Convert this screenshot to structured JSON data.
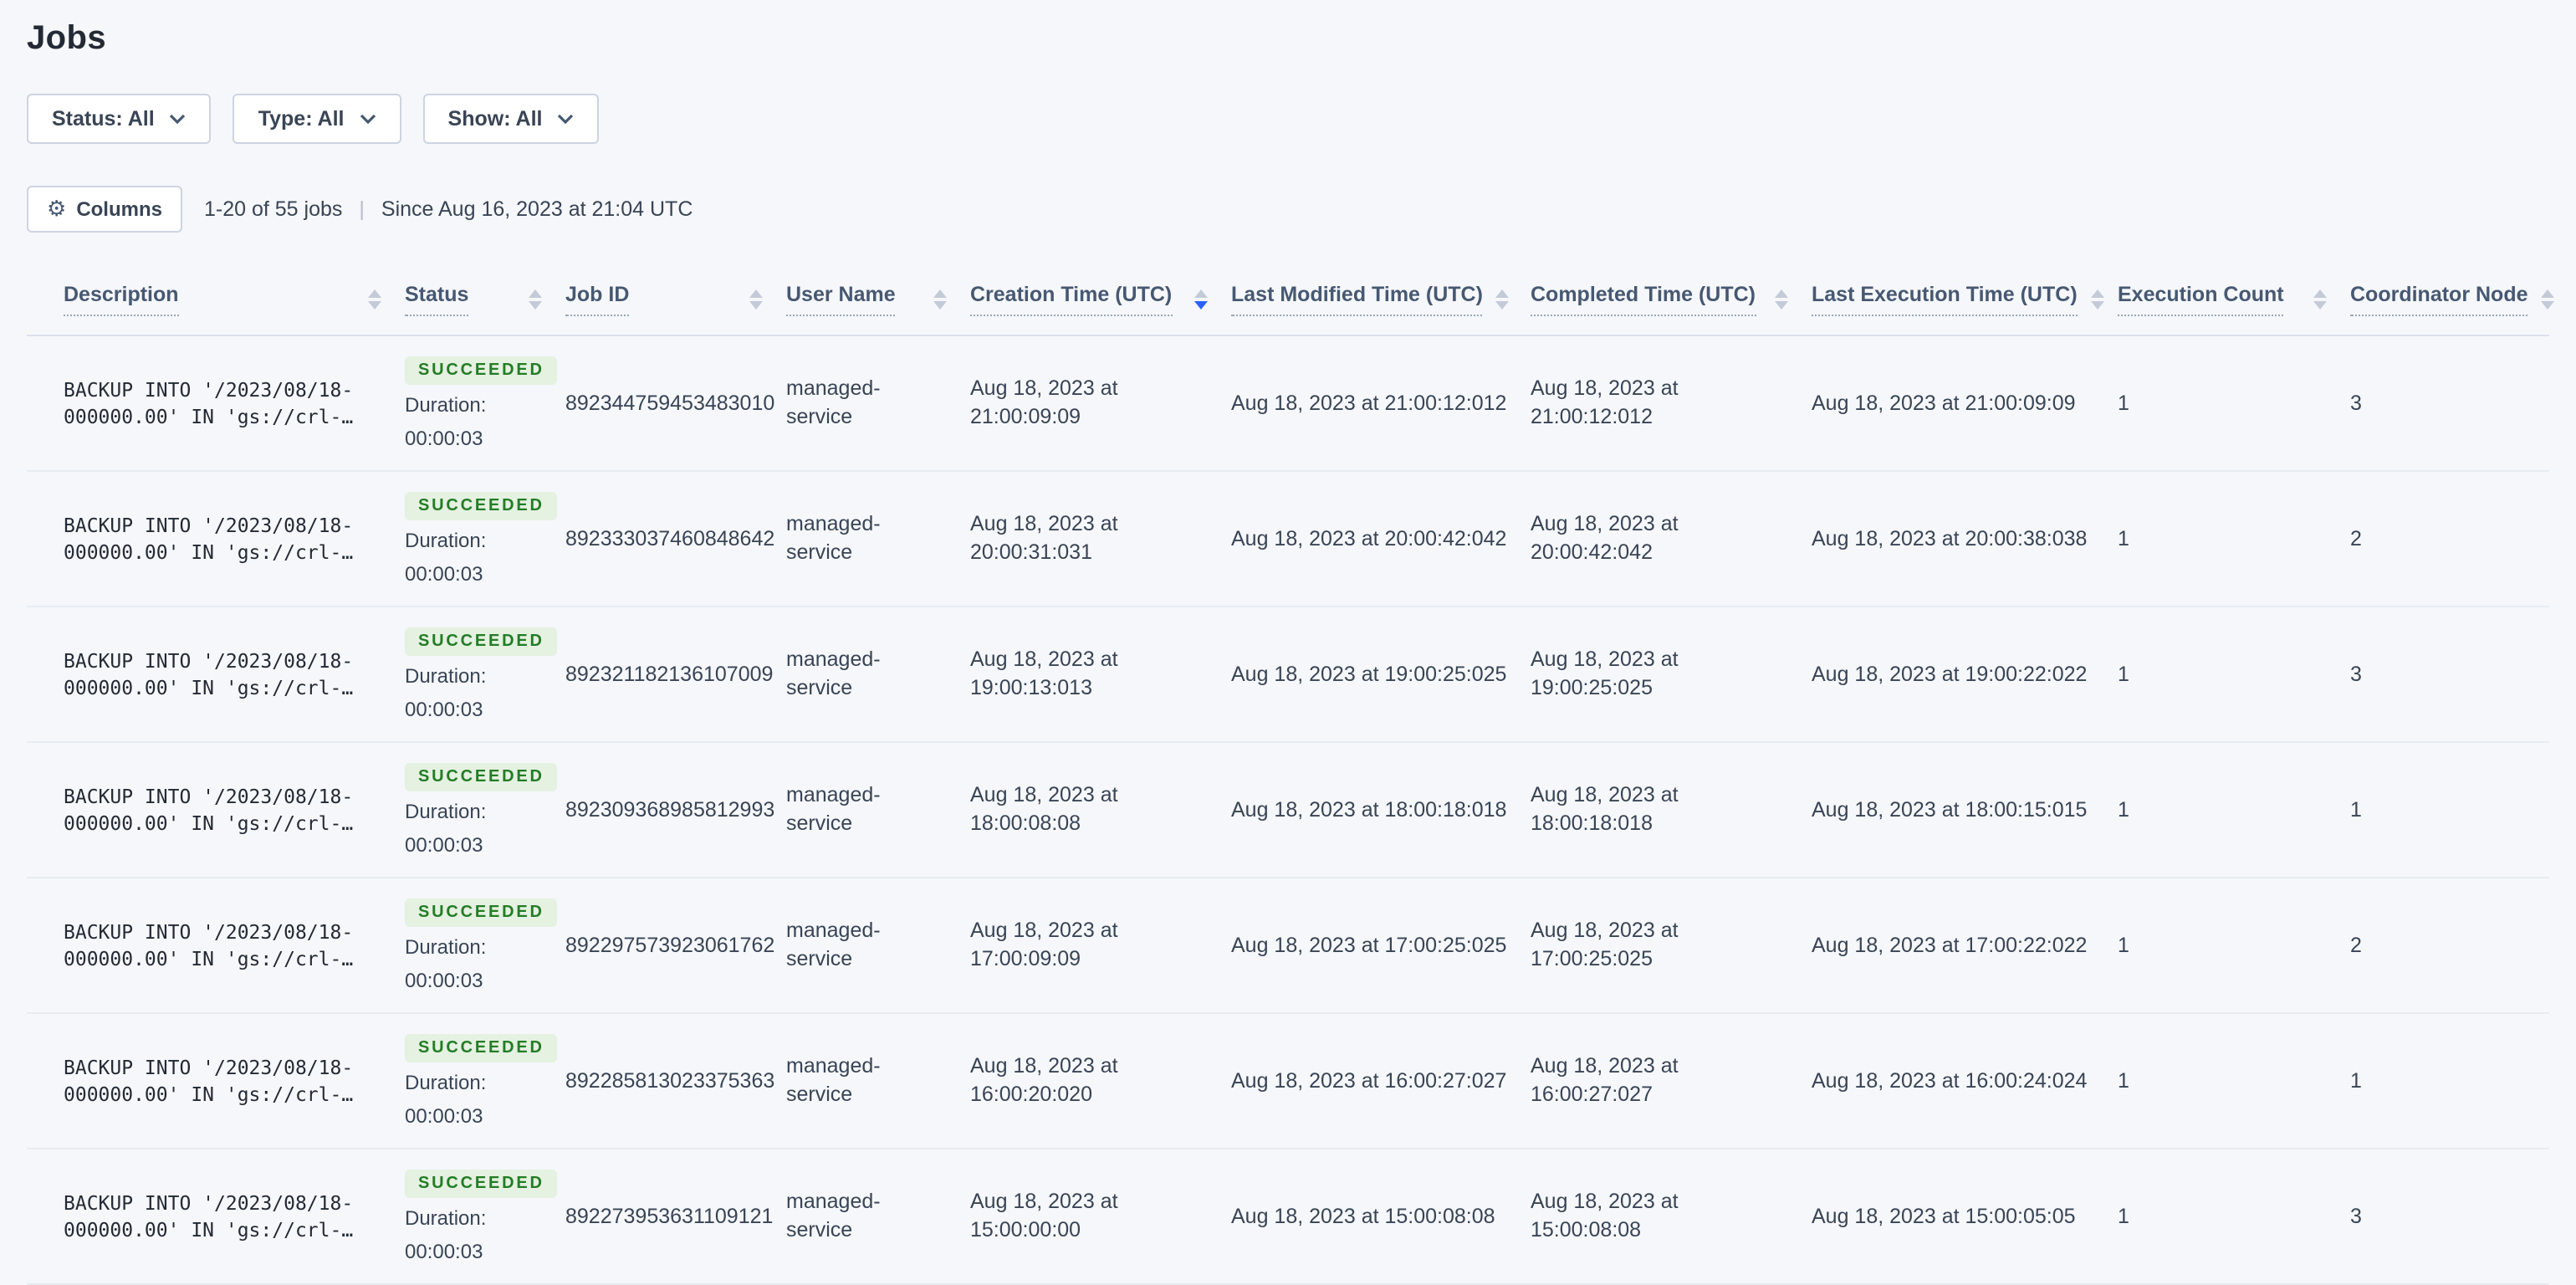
{
  "page": {
    "title": "Jobs"
  },
  "filters": [
    {
      "label": "Status: All"
    },
    {
      "label": "Type: All"
    },
    {
      "label": "Show: All"
    }
  ],
  "toolbar": {
    "columns_label": "Columns",
    "count_text": "1-20 of 55 jobs",
    "divider": "|",
    "since_text": "Since Aug 16, 2023 at 21:04 UTC"
  },
  "table": {
    "columns": [
      {
        "key": "description",
        "label": "Description",
        "sort": "none"
      },
      {
        "key": "status",
        "label": "Status",
        "sort": "none"
      },
      {
        "key": "job-id",
        "label": "Job ID",
        "sort": "none"
      },
      {
        "key": "user-name",
        "label": "User Name",
        "sort": "none"
      },
      {
        "key": "creation-time",
        "label": "Creation Time (UTC)",
        "sort": "desc"
      },
      {
        "key": "last-modified",
        "label": "Last Modified Time (UTC)",
        "sort": "none"
      },
      {
        "key": "completed-time",
        "label": "Completed Time (UTC)",
        "sort": "none"
      },
      {
        "key": "last-execution",
        "label": "Last Execution Time (UTC)",
        "sort": "none"
      },
      {
        "key": "execution-count",
        "label": "Execution Count",
        "sort": "none"
      },
      {
        "key": "coordinator-node",
        "label": "Coordinator Node",
        "sort": "none"
      }
    ],
    "rows": [
      {
        "description": "BACKUP INTO '/2023/08/18-000000.00' IN 'gs://crl-…",
        "status": "SUCCEEDED",
        "duration_label": "Duration:",
        "duration": "00:00:03",
        "job_id": "892344759453483010",
        "user_name": "managed-service",
        "creation_time": "Aug 18, 2023 at 21:00:09:09",
        "last_modified": "Aug 18, 2023 at 21:00:12:012",
        "completed": "Aug 18, 2023 at 21:00:12:012",
        "last_execution": "Aug 18, 2023 at 21:00:09:09",
        "execution_count": "1",
        "coordinator_node": "3"
      },
      {
        "description": "BACKUP INTO '/2023/08/18-000000.00' IN 'gs://crl-…",
        "status": "SUCCEEDED",
        "duration_label": "Duration:",
        "duration": "00:00:03",
        "job_id": "892333037460848642",
        "user_name": "managed-service",
        "creation_time": "Aug 18, 2023 at 20:00:31:031",
        "last_modified": "Aug 18, 2023 at 20:00:42:042",
        "completed": "Aug 18, 2023 at 20:00:42:042",
        "last_execution": "Aug 18, 2023 at 20:00:38:038",
        "execution_count": "1",
        "coordinator_node": "2"
      },
      {
        "description": "BACKUP INTO '/2023/08/18-000000.00' IN 'gs://crl-…",
        "status": "SUCCEEDED",
        "duration_label": "Duration:",
        "duration": "00:00:03",
        "job_id": "892321182136107009",
        "user_name": "managed-service",
        "creation_time": "Aug 18, 2023 at 19:00:13:013",
        "last_modified": "Aug 18, 2023 at 19:00:25:025",
        "completed": "Aug 18, 2023 at 19:00:25:025",
        "last_execution": "Aug 18, 2023 at 19:00:22:022",
        "execution_count": "1",
        "coordinator_node": "3"
      },
      {
        "description": "BACKUP INTO '/2023/08/18-000000.00' IN 'gs://crl-…",
        "status": "SUCCEEDED",
        "duration_label": "Duration:",
        "duration": "00:00:03",
        "job_id": "892309368985812993",
        "user_name": "managed-service",
        "creation_time": "Aug 18, 2023 at 18:00:08:08",
        "last_modified": "Aug 18, 2023 at 18:00:18:018",
        "completed": "Aug 18, 2023 at 18:00:18:018",
        "last_execution": "Aug 18, 2023 at 18:00:15:015",
        "execution_count": "1",
        "coordinator_node": "1"
      },
      {
        "description": "BACKUP INTO '/2023/08/18-000000.00' IN 'gs://crl-…",
        "status": "SUCCEEDED",
        "duration_label": "Duration:",
        "duration": "00:00:03",
        "job_id": "892297573923061762",
        "user_name": "managed-service",
        "creation_time": "Aug 18, 2023 at 17:00:09:09",
        "last_modified": "Aug 18, 2023 at 17:00:25:025",
        "completed": "Aug 18, 2023 at 17:00:25:025",
        "last_execution": "Aug 18, 2023 at 17:00:22:022",
        "execution_count": "1",
        "coordinator_node": "2"
      },
      {
        "description": "BACKUP INTO '/2023/08/18-000000.00' IN 'gs://crl-…",
        "status": "SUCCEEDED",
        "duration_label": "Duration:",
        "duration": "00:00:03",
        "job_id": "892285813023375363",
        "user_name": "managed-service",
        "creation_time": "Aug 18, 2023 at 16:00:20:020",
        "last_modified": "Aug 18, 2023 at 16:00:27:027",
        "completed": "Aug 18, 2023 at 16:00:27:027",
        "last_execution": "Aug 18, 2023 at 16:00:24:024",
        "execution_count": "1",
        "coordinator_node": "1"
      },
      {
        "description": "BACKUP INTO '/2023/08/18-000000.00' IN 'gs://crl-…",
        "status": "SUCCEEDED",
        "duration_label": "Duration:",
        "duration": "00:00:03",
        "job_id": "892273953631109121",
        "user_name": "managed-service",
        "creation_time": "Aug 18, 2023 at 15:00:00:00",
        "last_modified": "Aug 18, 2023 at 15:00:08:08",
        "completed": "Aug 18, 2023 at 15:00:08:08",
        "last_execution": "Aug 18, 2023 at 15:00:05:05",
        "execution_count": "1",
        "coordinator_node": "3"
      }
    ]
  },
  "icons": {
    "gear": "⚙",
    "columns_button_icon": "gear-icon",
    "filter_icon": "chevron-down-icon",
    "sort_icon": "sort-carets"
  },
  "colors": {
    "accent": "#2962ff",
    "badge_bg": "#e5f1e1",
    "badge_text": "#237d26",
    "page_bg": "#f5f7fa",
    "text_primary": "#394455"
  }
}
